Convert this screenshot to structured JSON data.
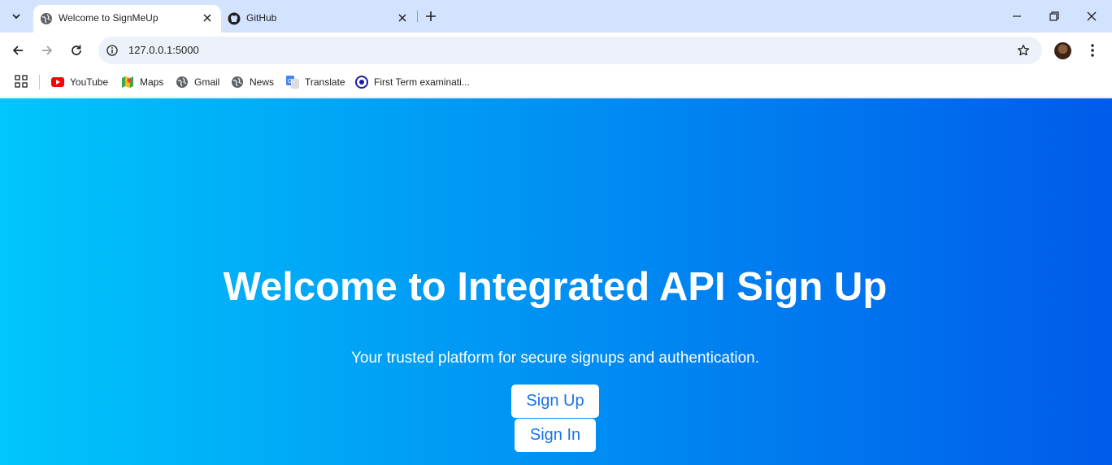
{
  "browser": {
    "tabs": [
      {
        "title": "Welcome to SignMeUp",
        "favicon": "globe-icon",
        "active": true
      },
      {
        "title": "GitHub",
        "favicon": "github-icon",
        "active": false
      }
    ],
    "url": "127.0.0.1:5000",
    "bookmarks": [
      {
        "label": "YouTube",
        "icon": "youtube-icon"
      },
      {
        "label": "Maps",
        "icon": "maps-icon"
      },
      {
        "label": "Gmail",
        "icon": "globe-icon"
      },
      {
        "label": "News",
        "icon": "globe-icon"
      },
      {
        "label": "Translate",
        "icon": "translate-icon"
      },
      {
        "label": "First Term examinati...",
        "icon": "circle-logo-icon"
      }
    ]
  },
  "page": {
    "title": "Welcome to Integrated API Sign Up",
    "subtitle": "Your trusted platform for secure signups and authentication.",
    "signup_label": "Sign Up",
    "signin_label": "Sign In"
  },
  "colors": {
    "gradient_start": "#00c6fb",
    "gradient_end": "#005bea",
    "button_text": "#1a73e8",
    "tabstrip_bg": "#d3e3fd"
  }
}
